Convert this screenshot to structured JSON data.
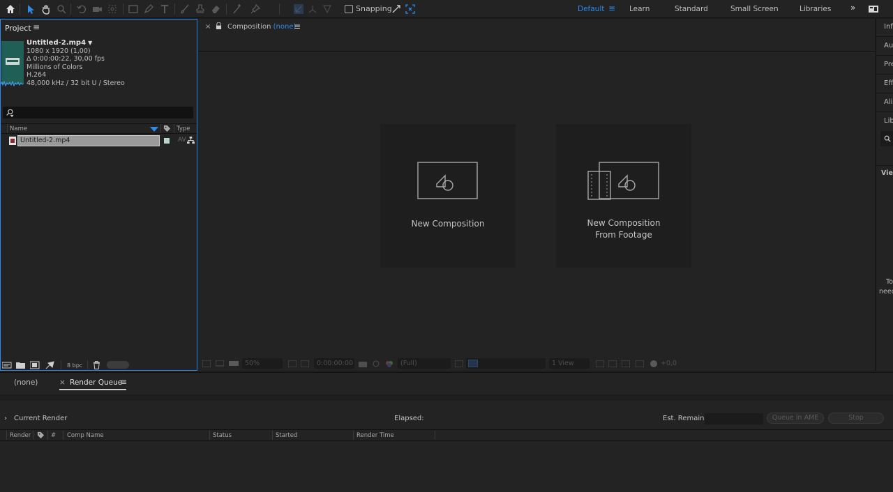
{
  "toolbar": {
    "snapping_label": "Snapping",
    "workspaces": [
      "Default",
      "Learn",
      "Standard",
      "Small Screen",
      "Libraries"
    ],
    "active_workspace": "Default",
    "accent_color": "#2d8ceb"
  },
  "project": {
    "panel_title": "Project",
    "footage": {
      "name": "Untitled-2.mp4",
      "dimensions": "1080 x 1920 (1,00)",
      "duration": "Δ 0:00:00:22, 30,00 fps",
      "colors": "Millions of Colors",
      "codec": "H.264",
      "audio": "48,000 kHz / 32 bit U / Stereo"
    },
    "columns": {
      "name": "Name",
      "type": "Type"
    },
    "items": [
      {
        "name": "Untitled-2.mp4",
        "type": "AV"
      }
    ],
    "bit_depth": "8 bpc"
  },
  "composition": {
    "tab_prefix": "Composition",
    "tab_value": "(none)",
    "cards": {
      "new_comp": "New Composition",
      "from_footage_line1": "New Composition",
      "from_footage_line2": "From Footage"
    },
    "bottom_bar": {
      "zoom": "50%",
      "timecode": "0:00:00:00",
      "resolution": "(Full)",
      "views": "1 View",
      "exposure": "+0,0"
    }
  },
  "right_panel": {
    "tabs": [
      "Info",
      "Audio",
      "Preview",
      "Effects & Presets",
      "Align",
      "Libraries"
    ],
    "view_label": "View",
    "message_line1": "To",
    "message_line2": "need"
  },
  "render_queue": {
    "tabs": [
      "(none)",
      "Render Queue"
    ],
    "current_render": "Current Render",
    "elapsed": "Elapsed:",
    "est_remain": "Est. Remain:",
    "queue_in_ame": "Queue in AME",
    "stop": "Stop",
    "columns": [
      "Render",
      "#",
      "Comp Name",
      "Status",
      "Started",
      "Render Time"
    ]
  }
}
